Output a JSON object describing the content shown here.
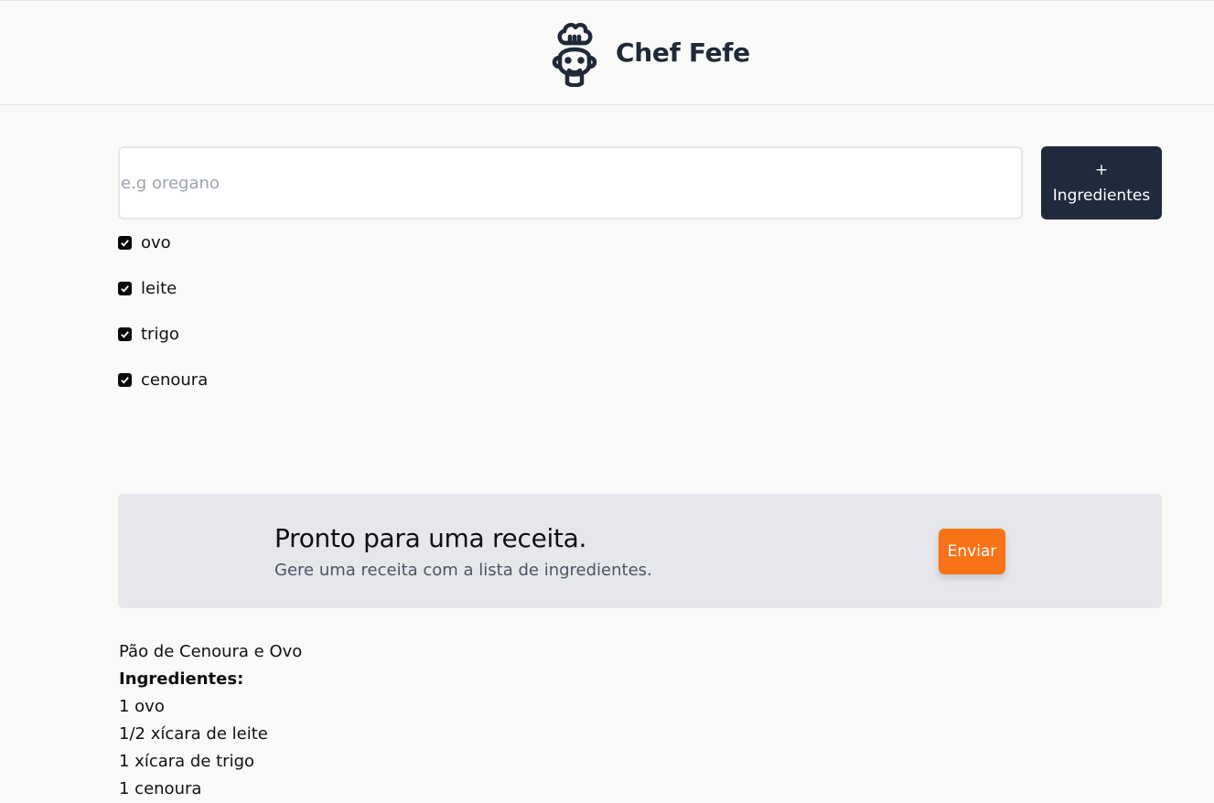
{
  "header": {
    "title": "Chef Fefe",
    "logo_icon": "chef-face-icon"
  },
  "search": {
    "placeholder": "e.g oregano",
    "value": ""
  },
  "add_button": {
    "plus": "+",
    "label": "Ingredientes"
  },
  "ingredients": [
    {
      "label": "ovo",
      "checked": true
    },
    {
      "label": "leite",
      "checked": true
    },
    {
      "label": "trigo",
      "checked": true
    },
    {
      "label": "cenoura",
      "checked": true
    }
  ],
  "cta": {
    "title": "Pronto para uma receita.",
    "subtitle": "Gere uma receita com a lista de ingredientes.",
    "button_label": "Enviar"
  },
  "recipe": {
    "title": "Pão de Cenoura e Ovo",
    "ingredients_heading": "Ingredientes:",
    "items": [
      "1 ovo",
      "1/2 xícara de leite",
      "1 xícara de trigo",
      "1 cenoura"
    ]
  },
  "colors": {
    "dark": "#1f2a3c",
    "accent": "#f97316",
    "panel": "#e5e7eb"
  }
}
